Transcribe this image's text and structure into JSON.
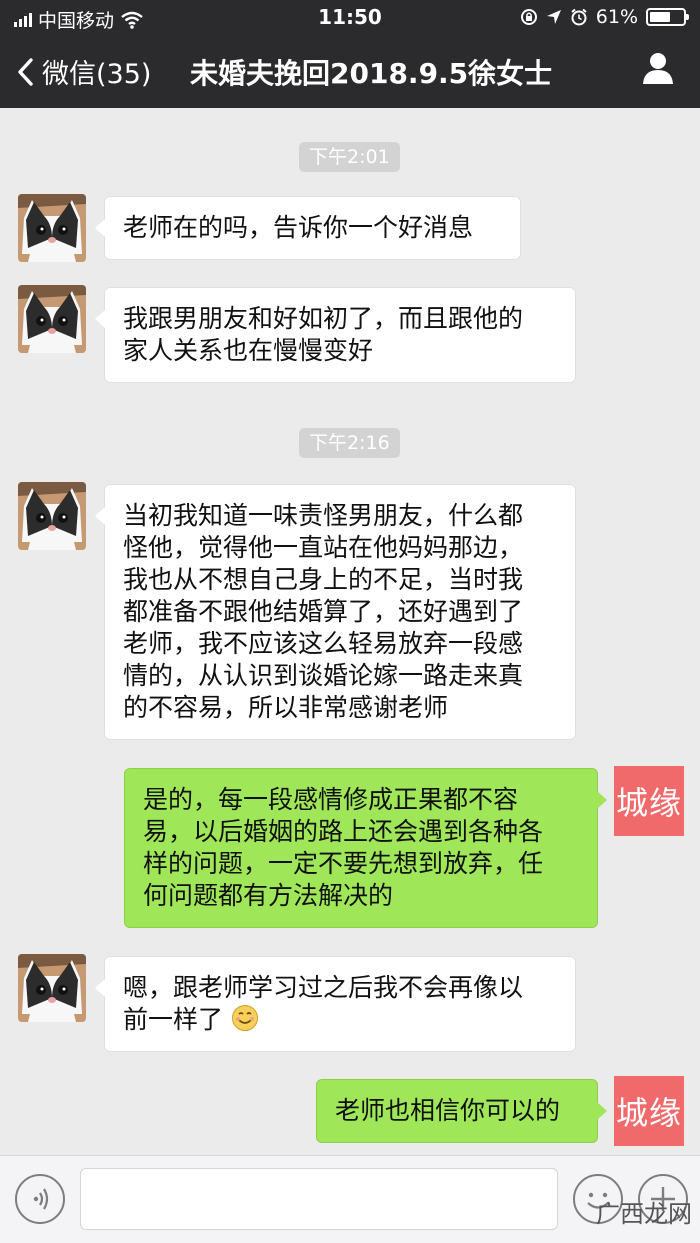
{
  "status_bar": {
    "carrier": "中国移动",
    "time": "11:50",
    "battery": "61%",
    "battery_level": 0.61
  },
  "nav": {
    "back_label": "微信(35)",
    "title": "未婚夫挽回2018.9.5徐女士"
  },
  "timestamps": [
    "下午2:01",
    "下午2:16"
  ],
  "messages": [
    {
      "side": "in",
      "lines": [
        "老师在的吗，告诉你一个好消息"
      ]
    },
    {
      "side": "in",
      "lines": [
        "我跟男朋友和好如初了，而且跟他的",
        "家人关系也在慢慢变好"
      ]
    },
    {
      "side": "in",
      "lines": [
        "当初我知道一味责怪男朋友，什么都",
        "怪他，觉得他一直站在他妈妈那边，",
        "我也从不想自己身上的不足，当时我",
        "都准备不跟他结婚算了，还好遇到了",
        "老师，我不应该这么轻易放弃一段感",
        "情的，从认识到谈婚论嫁一路走来真",
        "的不容易，所以非常感谢老师"
      ]
    },
    {
      "side": "out",
      "lines": [
        "是的，每一段感情修成正果都不容",
        "易，以后婚姻的路上还会遇到各种各",
        "样的问题，一定不要先想到放弃，任",
        "何问题都有方法解决的"
      ]
    },
    {
      "side": "in",
      "lines": [
        "嗯，跟老师学习过之后我不会再像以",
        "前一样了"
      ]
    },
    {
      "side": "out",
      "lines": [
        "老师也相信你可以的"
      ]
    }
  ],
  "sender_logo_text": "城缘",
  "watermark": "广西龙网",
  "icons": {
    "back": "chevron-left-icon",
    "profile": "person-icon",
    "voice": "voice-icon",
    "emoji": "emoji-icon",
    "plus": "plus-icon"
  },
  "colors": {
    "bar_bg": "#2b2b2d",
    "chat_bg": "#ebebeb",
    "outgoing_bubble": "#9fe658",
    "incoming_bubble": "#ffffff",
    "logo_bg": "#f06a6c"
  }
}
